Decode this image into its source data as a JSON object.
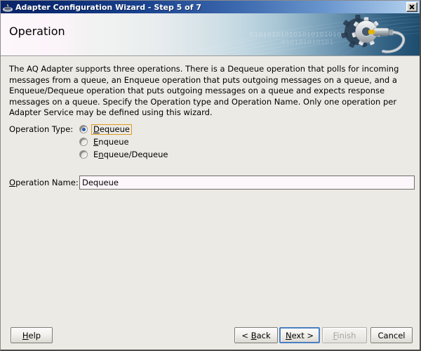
{
  "window": {
    "title": "Adapter Configuration Wizard - Step 5 of 7",
    "icon": "oracle-wizard-icon",
    "close_label": "Close"
  },
  "banner": {
    "title": "Operation",
    "bits_row1": "0101010101010101010101010101",
    "bits_row2": "010101010101",
    "gear_icon": "gear-wrench-icon"
  },
  "content": {
    "description": "The AQ Adapter supports three operations.  There is a Dequeue operation that polls for incoming messages from a queue, an Enqueue operation that puts outgoing messages on a queue, and a Enqueue/Dequeue operation that puts outgoing messages on a queue and expects response messages on a queue.  Specify the Operation type and Operation Name. Only one operation per Adapter Service may be defined using this wizard.",
    "operation_type": {
      "label": "Operation Type:",
      "label_mnemonic": "",
      "selected": "Dequeue",
      "focused": "Dequeue",
      "options": [
        {
          "label": "Dequeue",
          "mnemonic": "D",
          "checked": true,
          "focused": true
        },
        {
          "label": "Enqueue",
          "mnemonic": "E",
          "checked": false,
          "focused": false
        },
        {
          "label": "Enqueue/Dequeue",
          "mnemonic": "n",
          "checked": false,
          "focused": false
        }
      ]
    },
    "operation_name": {
      "label": "Operation Name:",
      "label_mnemonic": "O",
      "value": "Dequeue",
      "placeholder": ""
    }
  },
  "buttons": {
    "help": {
      "label": "Help",
      "mnemonic": "H",
      "enabled": true,
      "default": false
    },
    "back": {
      "label": "< Back",
      "mnemonic": "B",
      "enabled": true,
      "default": false
    },
    "next": {
      "label": "Next >",
      "mnemonic": "N",
      "enabled": true,
      "default": true
    },
    "finish": {
      "label": "Finish",
      "mnemonic": "F",
      "enabled": false,
      "default": false
    },
    "cancel": {
      "label": "Cancel",
      "mnemonic": "",
      "enabled": true,
      "default": false
    }
  },
  "colors": {
    "titlebar_start": "#0a246a",
    "titlebar_end": "#b9d4f0",
    "dialog_bg": "#eceae4",
    "banner_right": "#1d4c6d",
    "field_bg": "#fdf6fb",
    "focus_orange": "#e09a22",
    "default_button_blue": "#4a7fc1",
    "radio_dot": "#2a5db0"
  }
}
